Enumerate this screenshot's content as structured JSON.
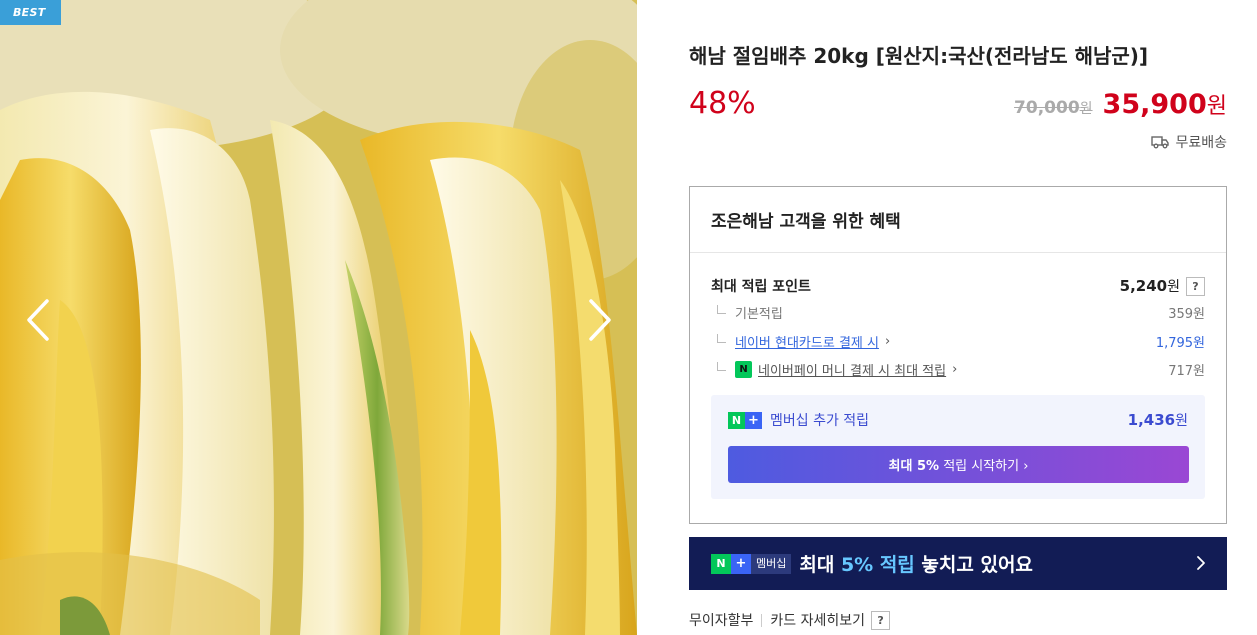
{
  "gallery": {
    "badge": "BEST",
    "image_icon": "napa-cabbage-photo",
    "prev_icon": "chevron-left-icon",
    "next_icon": "chevron-right-icon"
  },
  "product": {
    "title": "해남 절임배추 20kg [원산지:국산(전라남도 해남군)]",
    "discount": "48%",
    "original_price": "70,000",
    "original_price_unit": "원",
    "sale_price": "35,900",
    "sale_price_unit": "원",
    "shipping": "무료배송",
    "shipping_icon": "truck-icon"
  },
  "benefit": {
    "heading": "조은해남 고객을 위한 혜택",
    "max_points_label": "최대 적립 포인트",
    "max_points_value": "5,240",
    "max_points_unit": "원",
    "help": "?",
    "basic_label": "기본적립",
    "basic_value": "359원",
    "card_label": "네이버 현대카드로 결제 시",
    "card_value": "1,795원",
    "pay_icon_text": "N",
    "pay_label": "네이버페이 머니 결제 시 최대 적립",
    "pay_value": "717원",
    "member_label": "멤버십 추가 적립",
    "member_value": "1,436",
    "member_unit": "원",
    "start_btn_bold": "최대 5%",
    "start_btn_rest": " 적립 시작하기"
  },
  "banner": {
    "n": "N",
    "plus": "+",
    "badge": "멤버십",
    "msg_pre": "최대 ",
    "msg_hl": "5% 적립",
    "msg_post": " 놓치고 있어요"
  },
  "links": {
    "installment": "무이자할부",
    "card_detail": "카드 자세히보기",
    "help": "?"
  },
  "colors": {
    "price_red": "#d0021b",
    "best_badge": "#3a9fd8",
    "naver_green": "#03c75a",
    "banner_navy": "#121c55",
    "member_blue": "#3b4bd0"
  }
}
